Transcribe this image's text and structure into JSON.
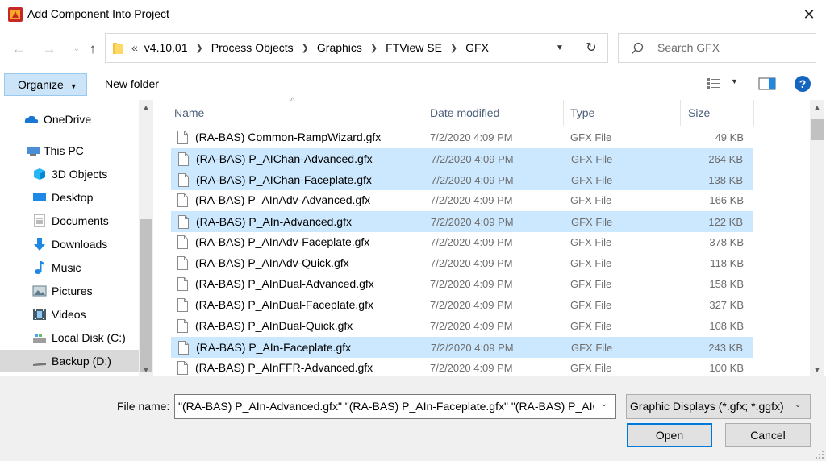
{
  "window": {
    "title": "Add Component Into Project"
  },
  "address": {
    "crumbs": [
      "«",
      "v4.10.01",
      "Process Objects",
      "Graphics",
      "FTView SE",
      "GFX"
    ]
  },
  "search": {
    "placeholder": "Search GFX"
  },
  "toolbar": {
    "organize": "Organize",
    "new_folder": "New folder",
    "help": "?"
  },
  "sidebar": {
    "items": [
      {
        "label": "OneDrive",
        "icon": "cloud-icon"
      },
      {
        "label": "This PC",
        "icon": "computer-icon"
      },
      {
        "label": "3D Objects",
        "icon": "cube-icon"
      },
      {
        "label": "Desktop",
        "icon": "desktop-icon"
      },
      {
        "label": "Documents",
        "icon": "document-icon"
      },
      {
        "label": "Downloads",
        "icon": "download-icon"
      },
      {
        "label": "Music",
        "icon": "music-icon"
      },
      {
        "label": "Pictures",
        "icon": "picture-icon"
      },
      {
        "label": "Videos",
        "icon": "video-icon"
      },
      {
        "label": "Local Disk (C:)",
        "icon": "drive-icon"
      },
      {
        "label": "Backup (D:)",
        "icon": "drive-icon"
      }
    ]
  },
  "columns": {
    "name": "Name",
    "date": "Date modified",
    "type": "Type",
    "size": "Size"
  },
  "files": [
    {
      "name": "(RA-BAS) Common-RampWizard.gfx",
      "date": "7/2/2020 4:09 PM",
      "type": "GFX File",
      "size": "49 KB",
      "selected": false
    },
    {
      "name": "(RA-BAS) P_AIChan-Advanced.gfx",
      "date": "7/2/2020 4:09 PM",
      "type": "GFX File",
      "size": "264 KB",
      "selected": true
    },
    {
      "name": "(RA-BAS) P_AIChan-Faceplate.gfx",
      "date": "7/2/2020 4:09 PM",
      "type": "GFX File",
      "size": "138 KB",
      "selected": true
    },
    {
      "name": "(RA-BAS) P_AInAdv-Advanced.gfx",
      "date": "7/2/2020 4:09 PM",
      "type": "GFX File",
      "size": "166 KB",
      "selected": false
    },
    {
      "name": "(RA-BAS) P_AIn-Advanced.gfx",
      "date": "7/2/2020 4:09 PM",
      "type": "GFX File",
      "size": "122 KB",
      "selected": true
    },
    {
      "name": "(RA-BAS) P_AInAdv-Faceplate.gfx",
      "date": "7/2/2020 4:09 PM",
      "type": "GFX File",
      "size": "378 KB",
      "selected": false
    },
    {
      "name": "(RA-BAS) P_AInAdv-Quick.gfx",
      "date": "7/2/2020 4:09 PM",
      "type": "GFX File",
      "size": "118 KB",
      "selected": false
    },
    {
      "name": "(RA-BAS) P_AInDual-Advanced.gfx",
      "date": "7/2/2020 4:09 PM",
      "type": "GFX File",
      "size": "158 KB",
      "selected": false
    },
    {
      "name": "(RA-BAS) P_AInDual-Faceplate.gfx",
      "date": "7/2/2020 4:09 PM",
      "type": "GFX File",
      "size": "327 KB",
      "selected": false
    },
    {
      "name": "(RA-BAS) P_AInDual-Quick.gfx",
      "date": "7/2/2020 4:09 PM",
      "type": "GFX File",
      "size": "108 KB",
      "selected": false
    },
    {
      "name": "(RA-BAS) P_AIn-Faceplate.gfx",
      "date": "7/2/2020 4:09 PM",
      "type": "GFX File",
      "size": "243 KB",
      "selected": true
    },
    {
      "name": "(RA-BAS) P_AInFFR-Advanced.gfx",
      "date": "7/2/2020 4:09 PM",
      "type": "GFX File",
      "size": "100 KB",
      "selected": false
    }
  ],
  "bottom": {
    "file_name_label": "File name:",
    "file_name_value": "\"(RA-BAS) P_AIn-Advanced.gfx\" \"(RA-BAS) P_AIn-Faceplate.gfx\" \"(RA-BAS) P_AIC",
    "filter": "Graphic Displays (*.gfx; *.ggfx)",
    "open": "Open",
    "cancel": "Cancel"
  },
  "colors": {
    "selection": "#cce8ff",
    "accent": "#0078d7",
    "folder": "#f5c342"
  }
}
